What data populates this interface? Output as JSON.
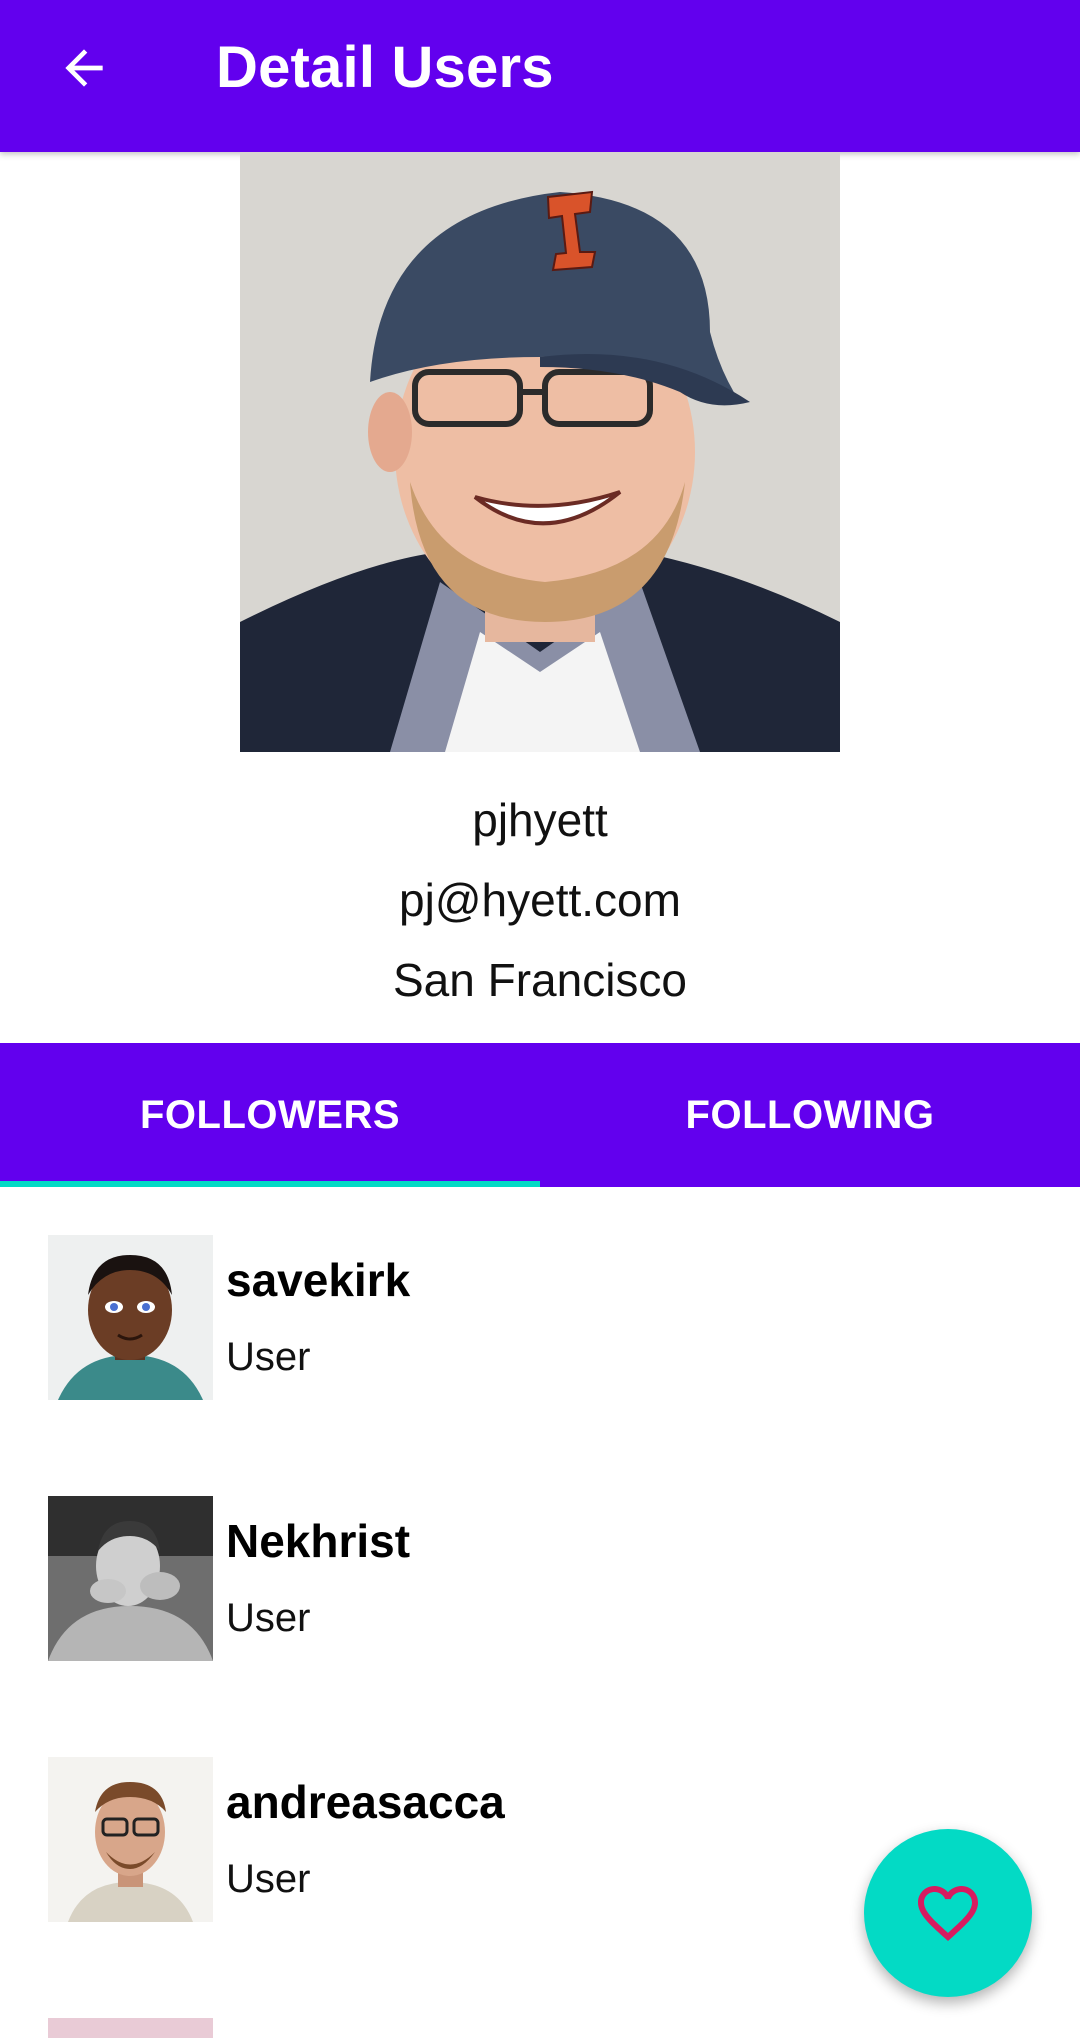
{
  "appbar": {
    "title": "Detail Users",
    "back_icon": "arrow-back-icon",
    "color": "#6200EE"
  },
  "profile": {
    "username": "pjhyett",
    "email": "pj@hyett.com",
    "location": "San Francisco"
  },
  "tabs": [
    {
      "label": "FOLLOWERS",
      "selected": true
    },
    {
      "label": "FOLLOWING",
      "selected": false
    }
  ],
  "accent_color": "#03DAC5",
  "users": [
    {
      "name": "savekirk",
      "type": "User"
    },
    {
      "name": "Nekhrist",
      "type": "User"
    },
    {
      "name": "andreasacca",
      "type": "User"
    }
  ],
  "fab": {
    "icon": "heart-outline-icon",
    "icon_color": "#D81B60"
  }
}
